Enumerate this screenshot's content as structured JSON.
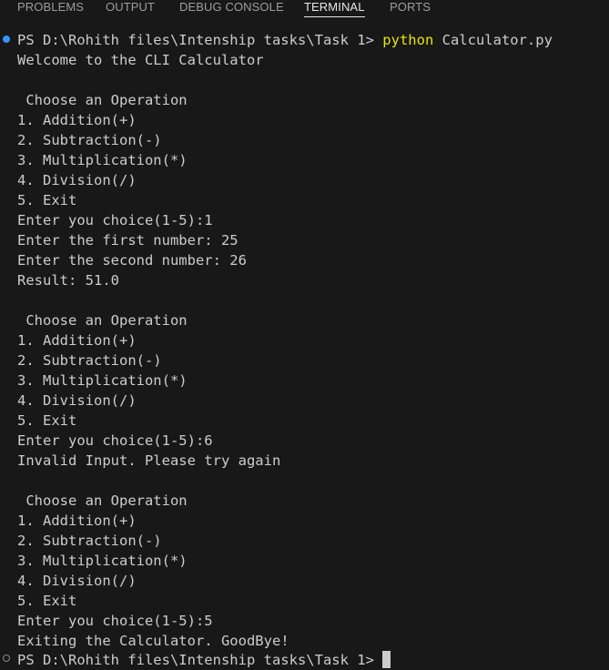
{
  "tabs": [
    {
      "label": "PROBLEMS",
      "active": false
    },
    {
      "label": "OUTPUT",
      "active": false
    },
    {
      "label": "DEBUG CONSOLE",
      "active": false
    },
    {
      "label": "TERMINAL",
      "active": true
    },
    {
      "label": "PORTS",
      "active": false
    }
  ],
  "terminal": {
    "prompt1": "PS D:\\Rohith files\\Intenship tasks\\Task 1> ",
    "command": "python",
    "command_arg": " Calculator.py",
    "lines": [
      "Welcome to the CLI Calculator",
      "",
      " Choose an Operation",
      "1. Addition(+)",
      "2. Subtraction(-)",
      "3. Multiplication(*)",
      "4. Division(/)",
      "5. Exit",
      "Enter you choice(1-5):1",
      "Enter the first number: 25",
      "Enter the second number: 26",
      "Result: 51.0",
      "",
      " Choose an Operation",
      "1. Addition(+)",
      "2. Subtraction(-)",
      "3. Multiplication(*)",
      "4. Division(/)",
      "5. Exit",
      "Enter you choice(1-5):6",
      "Invalid Input. Please try again",
      "",
      " Choose an Operation",
      "1. Addition(+)",
      "2. Subtraction(-)",
      "3. Multiplication(*)",
      "4. Division(/)",
      "5. Exit",
      "Enter you choice(1-5):5",
      "Exiting the Calculator. GoodBye!"
    ],
    "prompt2": "PS D:\\Rohith files\\Intenship tasks\\Task 1> "
  },
  "colors": {
    "background": "#181818",
    "text": "#cccccc",
    "command": "#e5e510",
    "decoration_success": "#3794ff",
    "decoration_default": "#8a8a8a"
  }
}
